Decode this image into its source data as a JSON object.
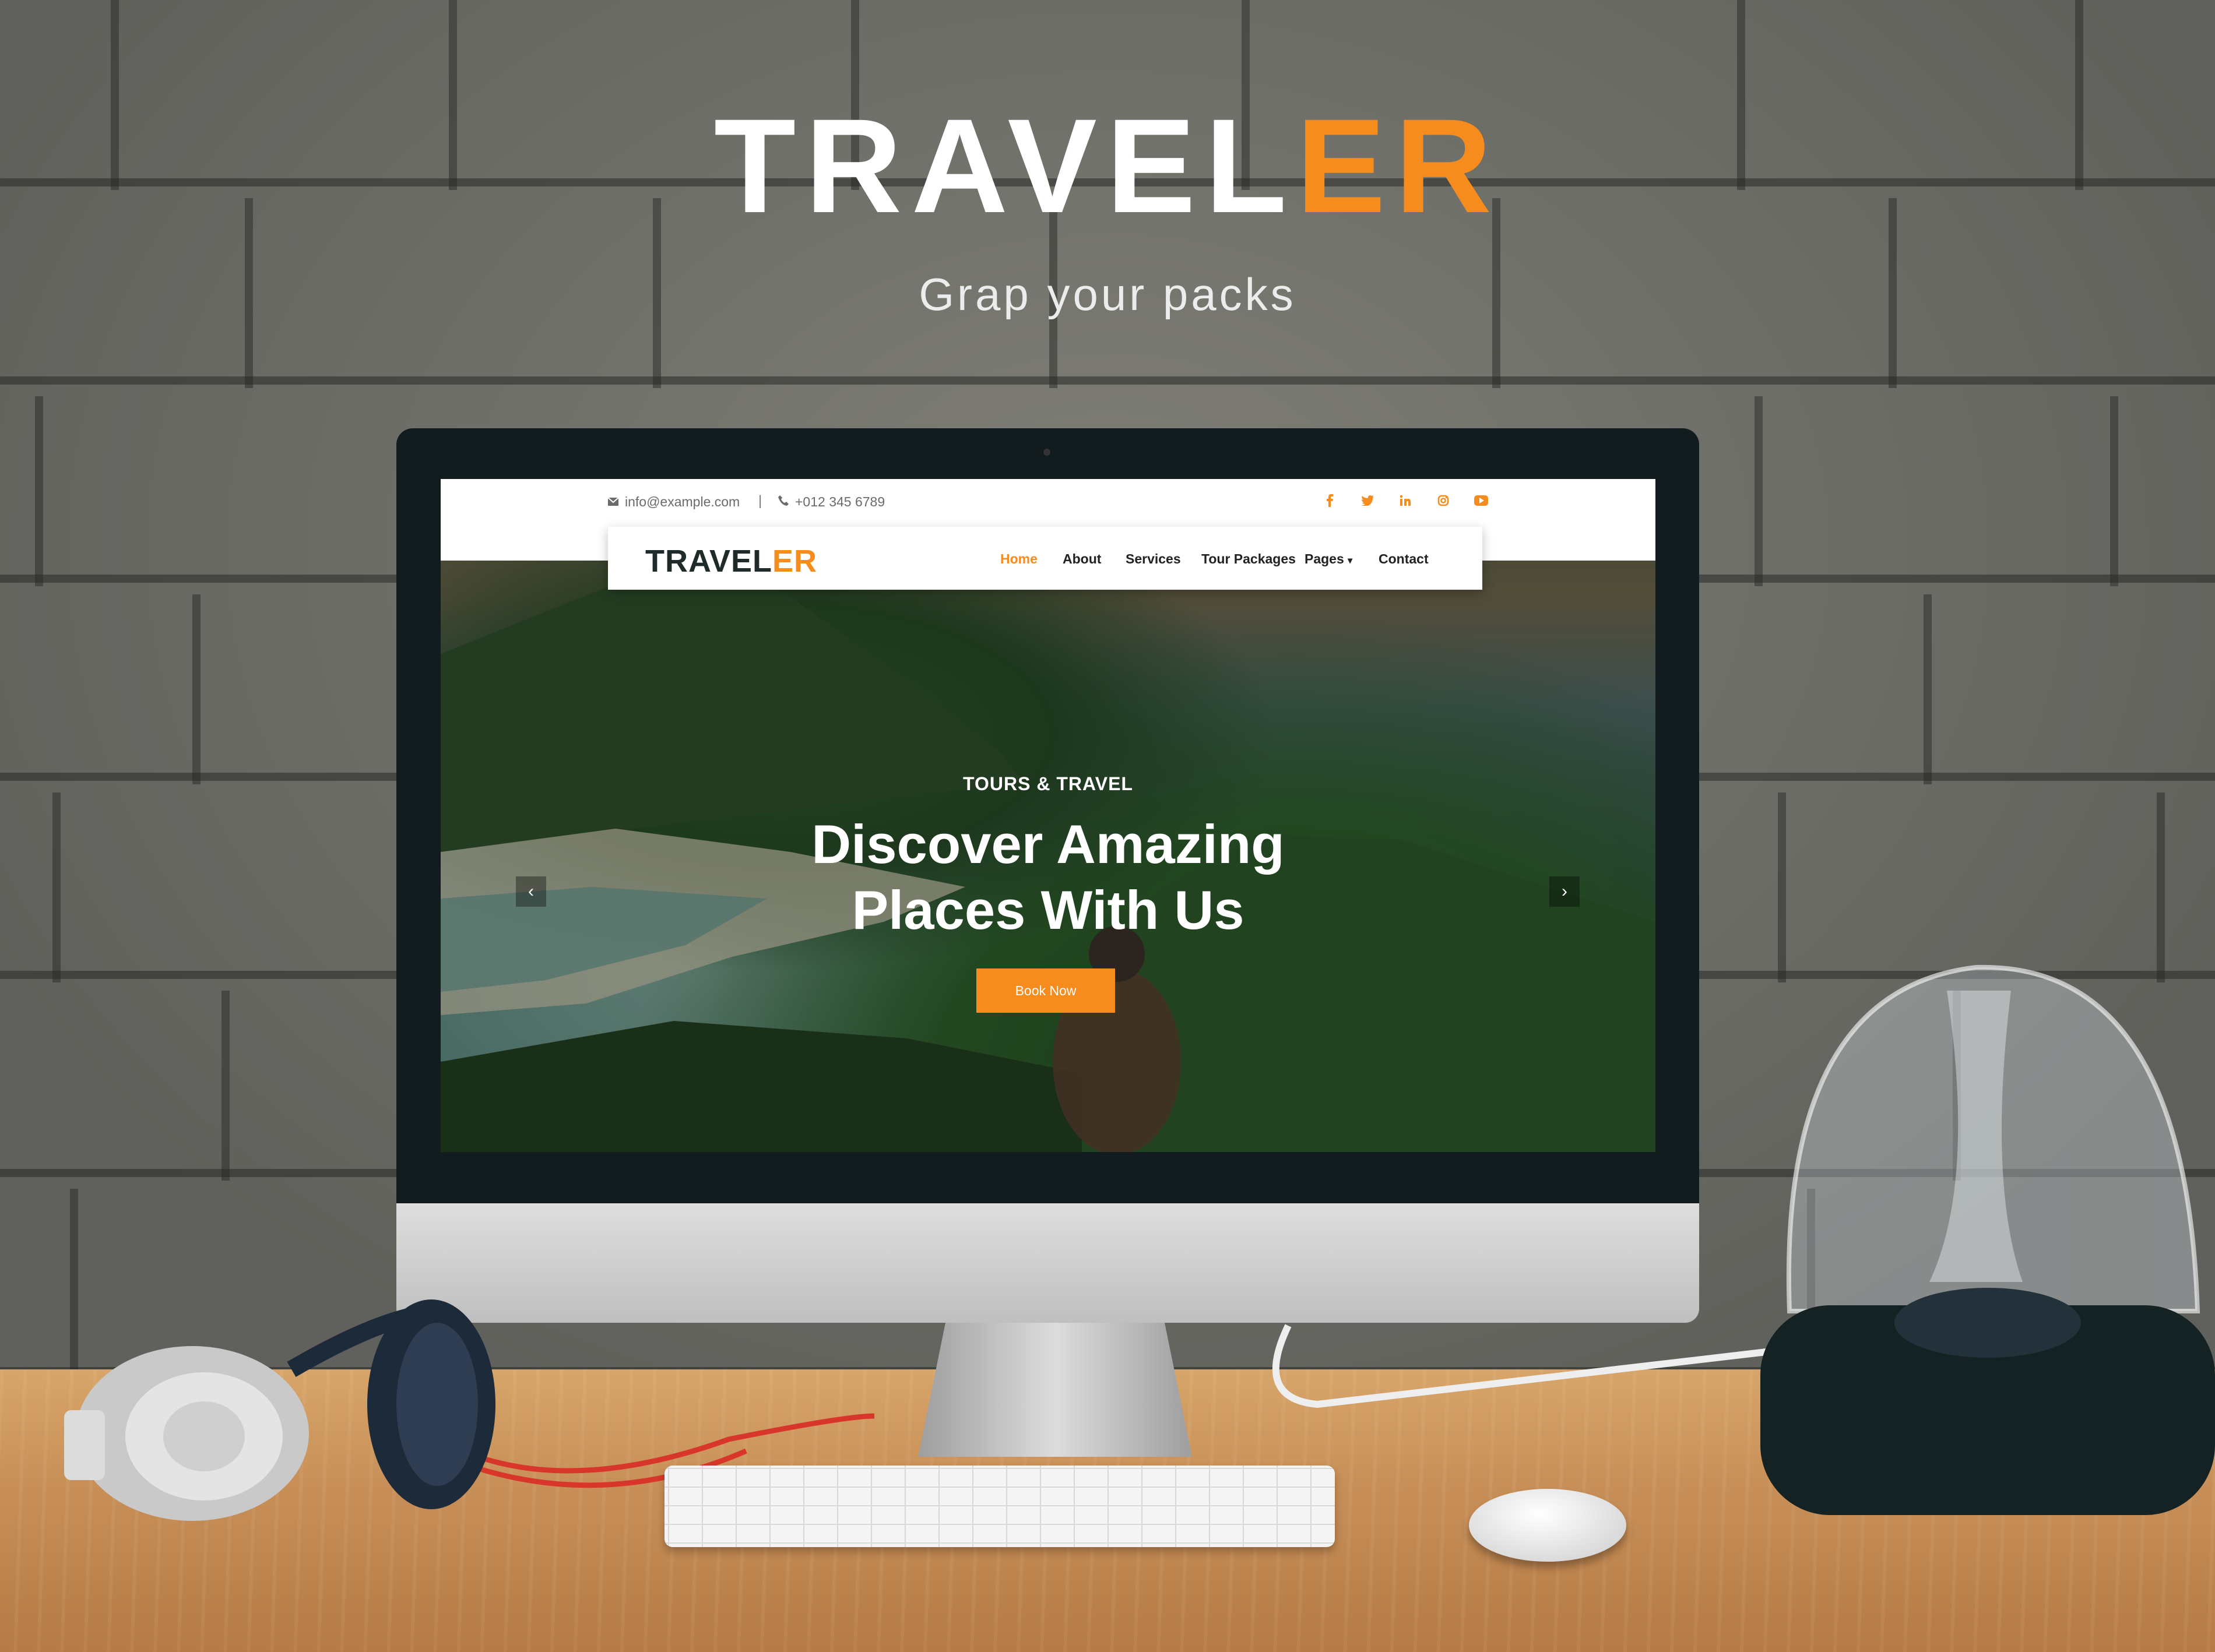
{
  "branding": {
    "title_main": "TRAVEL",
    "title_accent": "ER",
    "tagline": "Grap your packs"
  },
  "website": {
    "topbar": {
      "email": "info@example.com",
      "separator": "|",
      "phone": "+012 345 6789",
      "social_icons": [
        "facebook-icon",
        "twitter-icon",
        "linkedin-icon",
        "instagram-icon",
        "youtube-icon"
      ]
    },
    "navbar": {
      "logo_main": "TRAVEL",
      "logo_accent": "ER",
      "items": [
        {
          "label": "Home",
          "active": true
        },
        {
          "label": "About",
          "active": false
        },
        {
          "label": "Services",
          "active": false
        },
        {
          "label": "Tour Packages",
          "active": false
        },
        {
          "label": "Pages",
          "active": false,
          "dropdown": true
        },
        {
          "label": "Contact",
          "active": false
        }
      ]
    },
    "hero": {
      "subtitle": "TOURS & TRAVEL",
      "title_line1": "Discover Amazing",
      "title_line2": "Places With Us",
      "button": "Book Now",
      "prev_icon": "chevron-left-icon",
      "next_icon": "chevron-right-icon"
    }
  },
  "colors": {
    "accent": "#f68b1e",
    "dark": "#1f2b2b",
    "white": "#ffffff"
  }
}
